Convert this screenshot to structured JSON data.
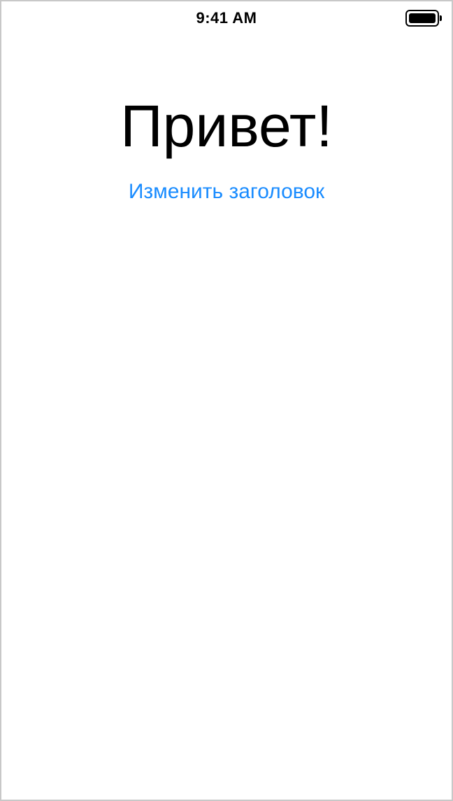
{
  "status_bar": {
    "time": "9:41 AM",
    "battery_icon": "battery-full-icon",
    "battery_level": 1.0
  },
  "main": {
    "title": "Привет!",
    "change_title_label": "Изменить заголовок"
  },
  "colors": {
    "accent": "#1a8cff",
    "title_text": "#000000",
    "background": "#ffffff"
  }
}
